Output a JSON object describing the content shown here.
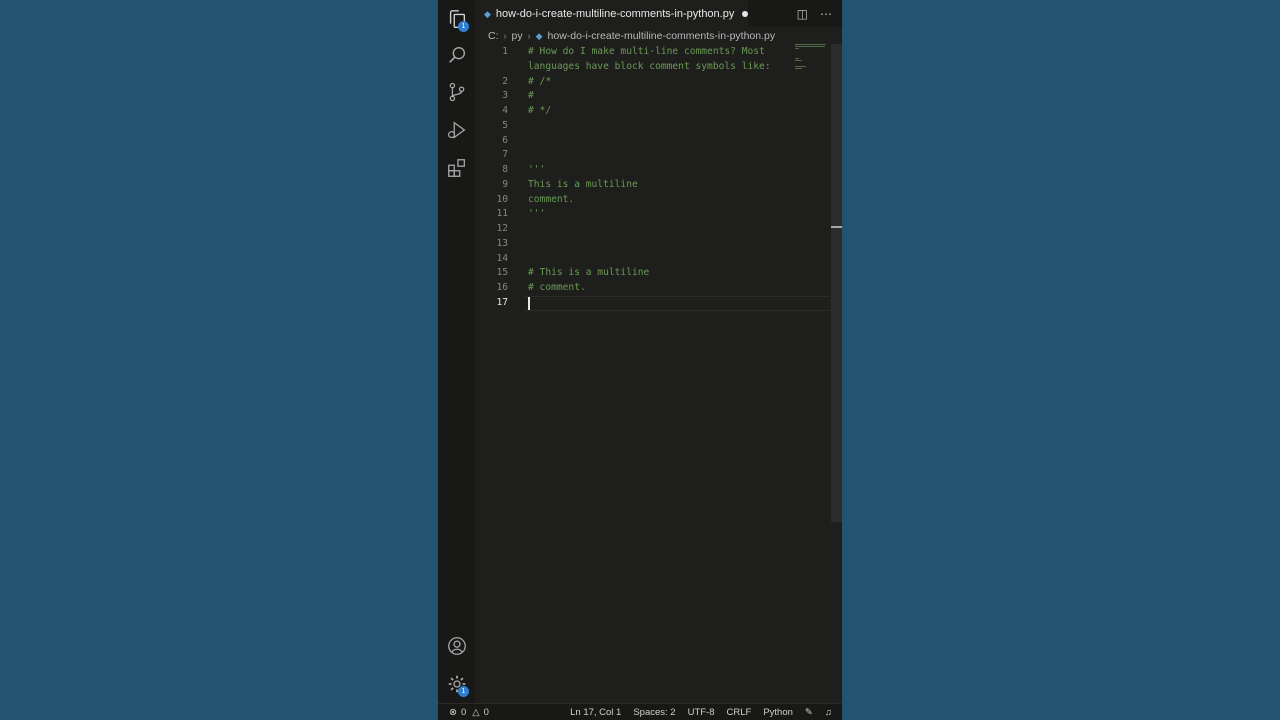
{
  "editor_tab": {
    "title": "how-do-i-create-multiline-comments-in-python.py",
    "dirty": true
  },
  "breadcrumb": {
    "drive": "C:",
    "folder": "py",
    "file": "how-do-i-create-multiline-comments-in-python.py"
  },
  "activity_bar": {
    "explorer_badge": "1",
    "settings_badge": "1",
    "icons": [
      "files-icon",
      "search-icon",
      "source-control-icon",
      "run-debug-icon",
      "extensions-icon",
      "account-icon",
      "gear-icon"
    ]
  },
  "lines": [
    {
      "number": "1",
      "text": "# How do I make multi-line comments? Most"
    },
    {
      "number": "",
      "text": "languages have block comment symbols like:"
    },
    {
      "number": "2",
      "text": "# /*"
    },
    {
      "number": "3",
      "text": "#"
    },
    {
      "number": "4",
      "text": "# */"
    },
    {
      "number": "5",
      "text": ""
    },
    {
      "number": "6",
      "text": ""
    },
    {
      "number": "7",
      "text": ""
    },
    {
      "number": "8",
      "text": "'''"
    },
    {
      "number": "9",
      "text": "This is a multiline"
    },
    {
      "number": "10",
      "text": "comment."
    },
    {
      "number": "11",
      "text": "'''"
    },
    {
      "number": "12",
      "text": ""
    },
    {
      "number": "13",
      "text": ""
    },
    {
      "number": "14",
      "text": ""
    },
    {
      "number": "15",
      "text": "# This is a multiline"
    },
    {
      "number": "16",
      "text": "# comment."
    },
    {
      "number": "17",
      "text": ""
    }
  ],
  "active_line": "17",
  "status_bar": {
    "errors": "0",
    "warnings": "0",
    "position": "Ln 17, Col 1",
    "indent": "Spaces: 2",
    "encoding": "UTF-8",
    "eol": "CRLF",
    "language": "Python"
  },
  "colors": {
    "comment": "#6a9955",
    "editor_bg": "#1e1f1c",
    "badge": "#2f7fd1",
    "page_bg": "#245371"
  }
}
